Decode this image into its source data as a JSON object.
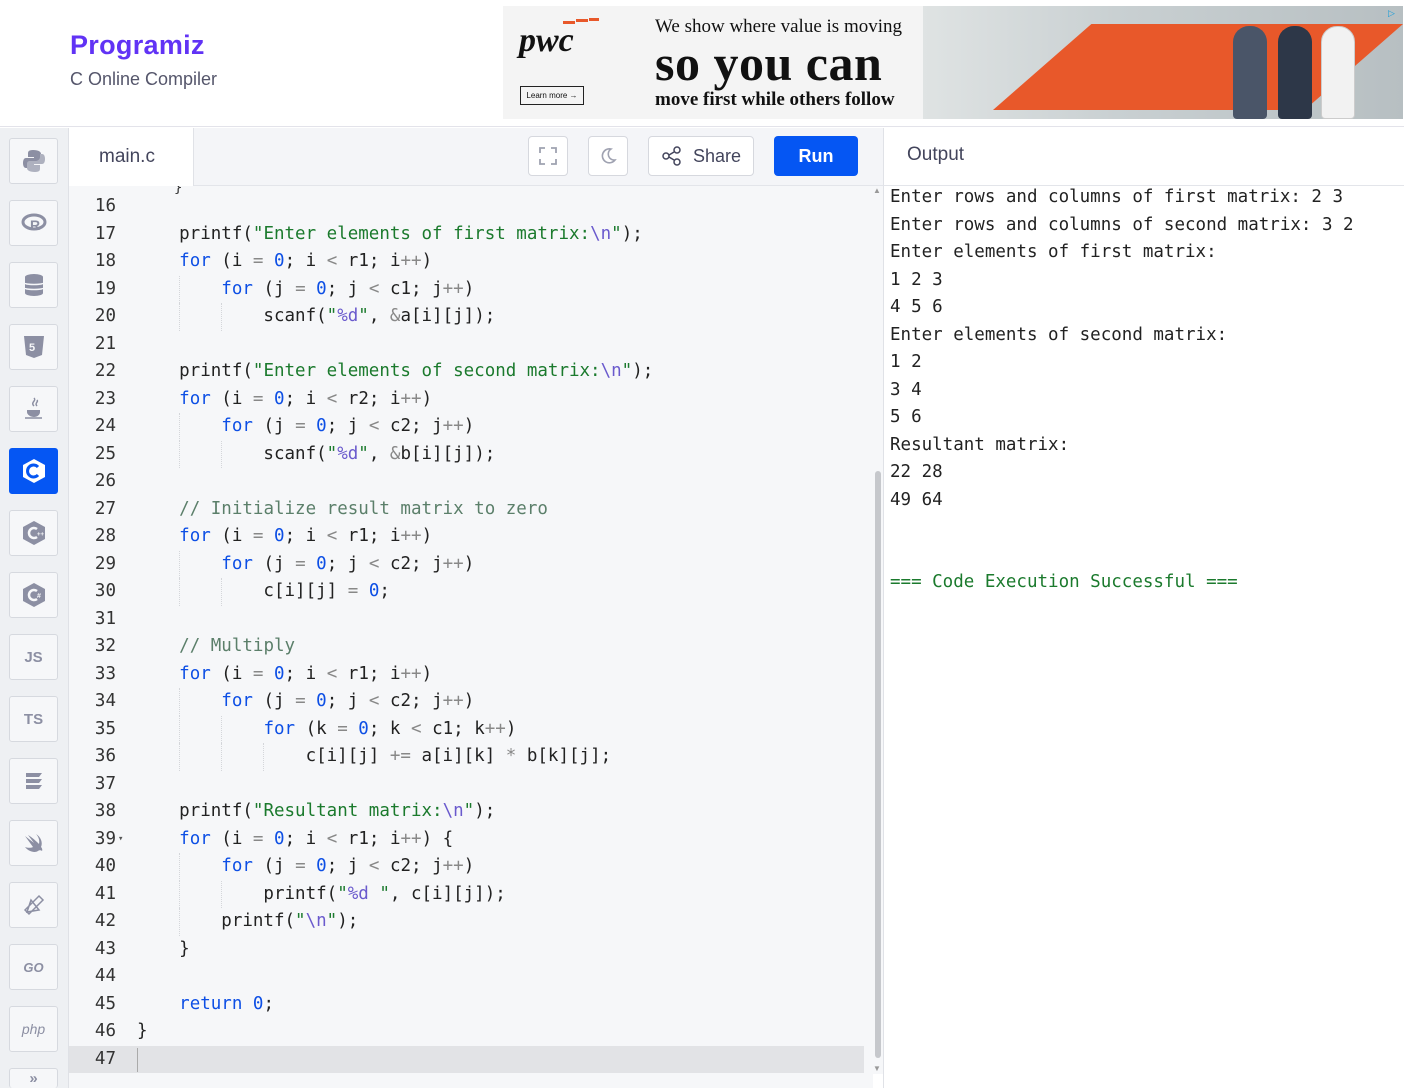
{
  "brand": {
    "logo": "Programiz",
    "subtitle": "C Online Compiler"
  },
  "ad": {
    "brand": "pwc",
    "learn_more": "Learn more →",
    "line1": "We show where value is moving",
    "line2": "so you can",
    "line3": "move first while others follow"
  },
  "sidebar": {
    "items": [
      {
        "name": "python",
        "label": ""
      },
      {
        "name": "r",
        "label": ""
      },
      {
        "name": "sql",
        "label": ""
      },
      {
        "name": "html",
        "label": ""
      },
      {
        "name": "java",
        "label": ""
      },
      {
        "name": "c",
        "label": ""
      },
      {
        "name": "cpp",
        "label": ""
      },
      {
        "name": "csharp",
        "label": ""
      },
      {
        "name": "js",
        "label": "JS"
      },
      {
        "name": "ts",
        "label": "TS"
      },
      {
        "name": "kotlin",
        "label": ""
      },
      {
        "name": "swift",
        "label": ""
      },
      {
        "name": "rust",
        "label": ""
      },
      {
        "name": "go",
        "label": "GO"
      },
      {
        "name": "php",
        "label": "php"
      }
    ],
    "active": "c"
  },
  "editor": {
    "file_tab": "main.c",
    "share_label": "Share",
    "run_label": "Run",
    "lines": [
      {
        "n": "16",
        "html": ""
      },
      {
        "n": "17",
        "html": "    printf(<span class=\"s\">\"Enter elements of first matrix:<span class=\"e\">\\n</span>\"</span>);"
      },
      {
        "n": "18",
        "html": "    <span class=\"k\">for</span> (i <span class=\"o\">=</span> <span class=\"n\">0</span>; i <span class=\"o\">&lt;</span> r1; i<span class=\"o\">++</span>)"
      },
      {
        "n": "19",
        "html": "        <span class=\"k\">for</span> (j <span class=\"o\">=</span> <span class=\"n\">0</span>; j <span class=\"o\">&lt;</span> c1; j<span class=\"o\">++</span>)"
      },
      {
        "n": "20",
        "html": "            scanf(<span class=\"s\">\"<span class=\"e\">%d</span>\"</span>, <span class=\"o\">&amp;</span>a[i][j]);"
      },
      {
        "n": "21",
        "html": ""
      },
      {
        "n": "22",
        "html": "    printf(<span class=\"s\">\"Enter elements of second matrix:<span class=\"e\">\\n</span>\"</span>);"
      },
      {
        "n": "23",
        "html": "    <span class=\"k\">for</span> (i <span class=\"o\">=</span> <span class=\"n\">0</span>; i <span class=\"o\">&lt;</span> r2; i<span class=\"o\">++</span>)"
      },
      {
        "n": "24",
        "html": "        <span class=\"k\">for</span> (j <span class=\"o\">=</span> <span class=\"n\">0</span>; j <span class=\"o\">&lt;</span> c2; j<span class=\"o\">++</span>)"
      },
      {
        "n": "25",
        "html": "            scanf(<span class=\"s\">\"<span class=\"e\">%d</span>\"</span>, <span class=\"o\">&amp;</span>b[i][j]);"
      },
      {
        "n": "26",
        "html": ""
      },
      {
        "n": "27",
        "html": "    <span class=\"c\">// Initialize result matrix to zero</span>"
      },
      {
        "n": "28",
        "html": "    <span class=\"k\">for</span> (i <span class=\"o\">=</span> <span class=\"n\">0</span>; i <span class=\"o\">&lt;</span> r1; i<span class=\"o\">++</span>)"
      },
      {
        "n": "29",
        "html": "        <span class=\"k\">for</span> (j <span class=\"o\">=</span> <span class=\"n\">0</span>; j <span class=\"o\">&lt;</span> c2; j<span class=\"o\">++</span>)"
      },
      {
        "n": "30",
        "html": "            c[i][j] <span class=\"o\">=</span> <span class=\"n\">0</span>;"
      },
      {
        "n": "31",
        "html": ""
      },
      {
        "n": "32",
        "html": "    <span class=\"c\">// Multiply</span>"
      },
      {
        "n": "33",
        "html": "    <span class=\"k\">for</span> (i <span class=\"o\">=</span> <span class=\"n\">0</span>; i <span class=\"o\">&lt;</span> r1; i<span class=\"o\">++</span>)"
      },
      {
        "n": "34",
        "html": "        <span class=\"k\">for</span> (j <span class=\"o\">=</span> <span class=\"n\">0</span>; j <span class=\"o\">&lt;</span> c2; j<span class=\"o\">++</span>)"
      },
      {
        "n": "35",
        "html": "            <span class=\"k\">for</span> (k <span class=\"o\">=</span> <span class=\"n\">0</span>; k <span class=\"o\">&lt;</span> c1; k<span class=\"o\">++</span>)"
      },
      {
        "n": "36",
        "html": "                c[i][j] <span class=\"o\">+=</span> a[i][k] <span class=\"o\">*</span> b[k][j];"
      },
      {
        "n": "37",
        "html": ""
      },
      {
        "n": "38",
        "html": "    printf(<span class=\"s\">\"Resultant matrix:<span class=\"e\">\\n</span>\"</span>);"
      },
      {
        "n": "39",
        "html": "    <span class=\"k\">for</span> (i <span class=\"o\">=</span> <span class=\"n\">0</span>; i <span class=\"o\">&lt;</span> r1; i<span class=\"o\">++</span>) {",
        "fold": true
      },
      {
        "n": "40",
        "html": "        <span class=\"k\">for</span> (j <span class=\"o\">=</span> <span class=\"n\">0</span>; j <span class=\"o\">&lt;</span> c2; j<span class=\"o\">++</span>)"
      },
      {
        "n": "41",
        "html": "            printf(<span class=\"s\">\"<span class=\"e\">%d</span> \"</span>, c[i][j]);"
      },
      {
        "n": "42",
        "html": "        printf(<span class=\"s\">\"<span class=\"e\">\\n</span>\"</span>);"
      },
      {
        "n": "43",
        "html": "    }"
      },
      {
        "n": "44",
        "html": ""
      },
      {
        "n": "45",
        "html": "    <span class=\"k\">return</span> <span class=\"n\">0</span>;"
      },
      {
        "n": "46",
        "html": "}"
      },
      {
        "n": "47",
        "html": "",
        "current": true
      }
    ]
  },
  "output": {
    "title": "Output",
    "lines": [
      "Enter rows and columns of first matrix: 2 3",
      "Enter rows and columns of second matrix: 3 2",
      "Enter elements of first matrix:",
      "1 2 3",
      "4 5 6",
      "Enter elements of second matrix:",
      "1 2",
      "3 4",
      "5 6",
      "Resultant matrix:",
      "22 28",
      "49 64"
    ],
    "status": "=== Code Execution Successful ==="
  }
}
